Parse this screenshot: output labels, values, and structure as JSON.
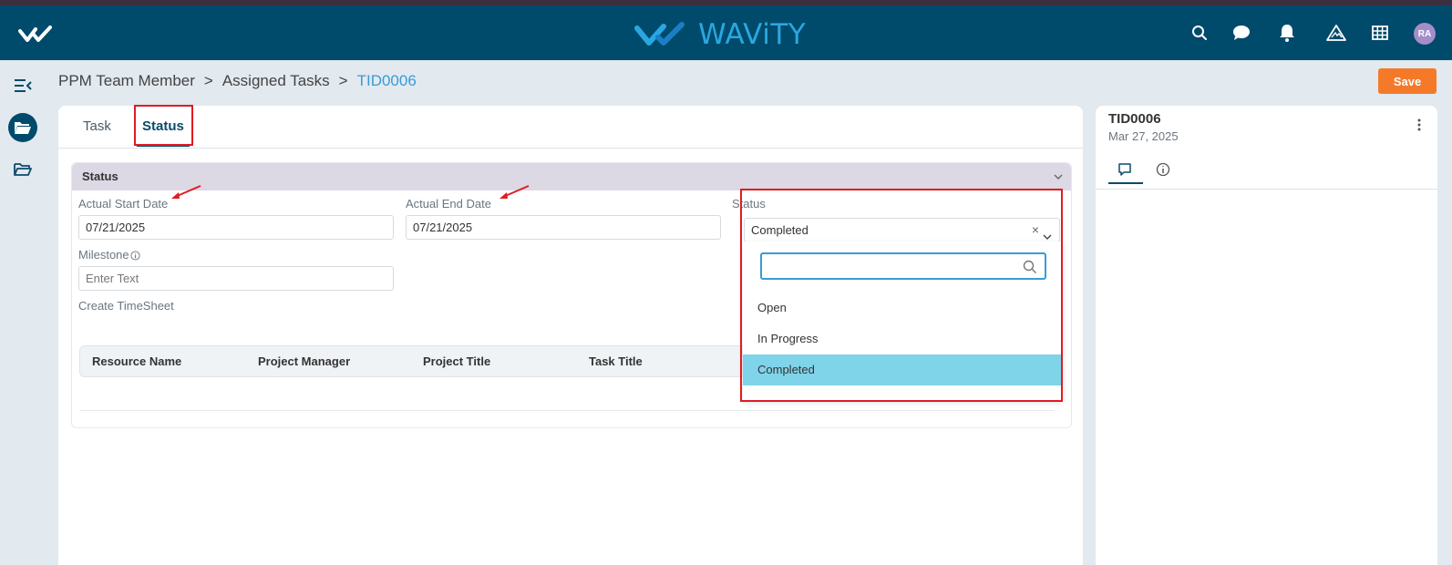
{
  "app": {
    "brand_name": "WAViTY",
    "user_initials": "RA"
  },
  "topbar": {
    "icons": [
      "home-check-icon",
      "search-icon",
      "chat-icon",
      "bell-icon",
      "triangle-alert-icon",
      "grid-icon"
    ]
  },
  "sidebar": {
    "items": [
      "collapse-menu-icon",
      "folder-open-icon",
      "folder-icon"
    ]
  },
  "breadcrumb": {
    "items": [
      "PPM Team Member",
      "Assigned Tasks"
    ],
    "separator": ">",
    "current": "TID0006"
  },
  "toolbar": {
    "save_label": "Save"
  },
  "tabs": [
    {
      "label": "Task"
    },
    {
      "label": "Status",
      "active": true
    }
  ],
  "section": {
    "title": "Status",
    "actual_start_date": {
      "label": "Actual Start Date",
      "value": "07/21/2025"
    },
    "actual_end_date": {
      "label": "Actual End Date",
      "value": "07/21/2025"
    },
    "status": {
      "label": "Status",
      "value": "Completed",
      "clear": "×"
    },
    "milestone": {
      "label": "Milestone",
      "placeholder": "Enter Text"
    },
    "create_timesheet_label": "Create TimeSheet",
    "table": {
      "columns": [
        "Resource Name",
        "Project Manager",
        "Project Title",
        "Task Title"
      ]
    }
  },
  "dropdown": {
    "search_value": "",
    "options": [
      "Open",
      "In Progress",
      "Completed"
    ],
    "selected": "Completed"
  },
  "right_panel": {
    "title": "TID0006",
    "date": "Mar 27, 2025",
    "tabs": [
      "comment-icon",
      "info-icon"
    ]
  },
  "colors": {
    "topbar": "#004a6b",
    "brand": "#2aa7e0",
    "save_button": "#f47a2a",
    "selected_option": "#7fd4ea",
    "annotation_red": "#e01b22"
  }
}
